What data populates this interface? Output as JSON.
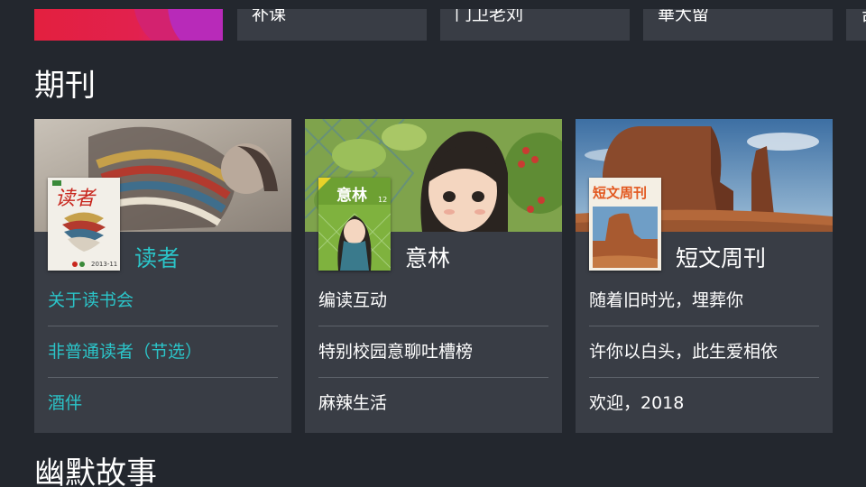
{
  "top_row": {
    "tiles": [
      "补课",
      "门卫老刘",
      "華大留",
      "吉"
    ]
  },
  "sections": {
    "periodicals_title": "期刊",
    "humor_title": "幽默故事"
  },
  "cards": [
    {
      "title": "读者",
      "cover_text": "读者",
      "cover_issue": "2013-11",
      "items": [
        "关于读书会",
        "非普通读者（节选）",
        "酒伴"
      ]
    },
    {
      "title": "意林",
      "cover_text": "意林",
      "cover_issue": "12",
      "items": [
        "编读互动",
        "特别校园意聊吐槽榜",
        "麻辣生活"
      ]
    },
    {
      "title": "短文周刊",
      "cover_text": "短文周刊",
      "items": [
        "随着旧时光，埋葬你",
        "许你以白头，此生爱相依",
        "欢迎，2018"
      ]
    }
  ],
  "colors": {
    "background": "#23272e",
    "card": "#393d45",
    "highlight": "#2bc4c8",
    "divider": "#5e636b"
  }
}
